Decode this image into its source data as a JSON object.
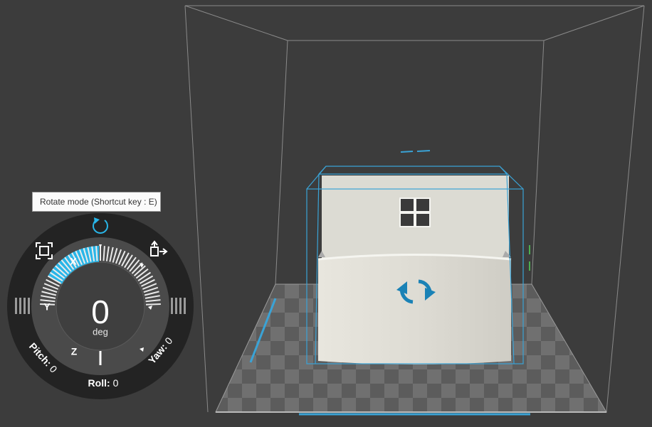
{
  "tooltip": {
    "text": "Rotate mode (Shortcut key : E)"
  },
  "rotate_panel": {
    "value": "0",
    "unit": "deg",
    "axes": {
      "x": "X",
      "y": "Y",
      "z": "Z"
    },
    "pitch": {
      "label": "Pitch:",
      "value": "0"
    },
    "roll": {
      "label": "Roll:",
      "value": "0"
    },
    "yaw": {
      "label": "Yaw:",
      "value": "0"
    }
  },
  "icons": [
    "rotate-mode-icon",
    "fit-to-bed-icon",
    "place-face-icon",
    "left-grip-icon",
    "right-grip-icon",
    "rotate-arrows-icon",
    "move-arrows-icon"
  ],
  "colors": {
    "accent": "#29b6e8",
    "background": "#3c3c3c",
    "model": "#dddbd3",
    "bbox": "#3aa3d6"
  }
}
